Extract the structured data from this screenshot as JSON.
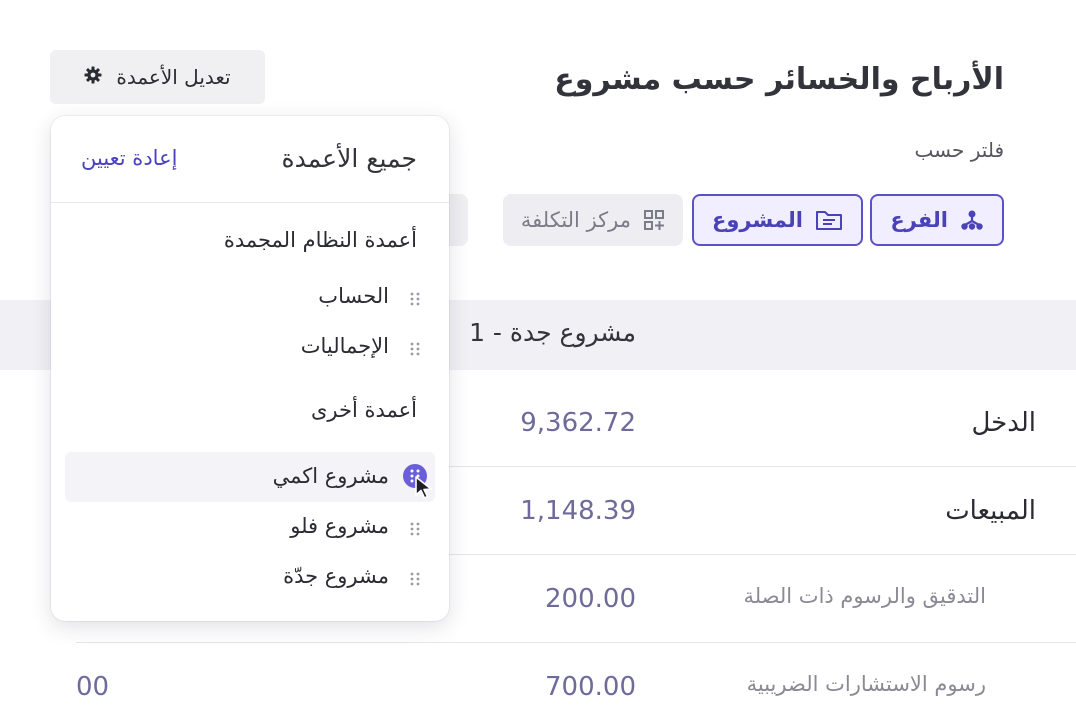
{
  "page": {
    "title": "الأرباح والخسائر حسب مشروع",
    "filter_label": "فلتر حسب",
    "edit_columns_label": "تعديل الأعمدة"
  },
  "filters": [
    {
      "label": "الفرع",
      "icon": "branch-icon",
      "active": true
    },
    {
      "label": "المشروع",
      "icon": "folder-icon",
      "active": true
    },
    {
      "label": "مركز التكلفة",
      "icon": "grid-plus-icon",
      "active": false
    }
  ],
  "table": {
    "project_header": "مشروع جدة - 1",
    "rows": [
      {
        "label": "الدخل",
        "value": "9,362.72",
        "extra": ""
      },
      {
        "label": "المبيعات",
        "value": "1,148.39",
        "extra": ""
      },
      {
        "label": "التدقيق والرسوم ذات الصلة",
        "value": "200.00",
        "extra": ""
      },
      {
        "label": "رسوم الاستشارات الضريبية",
        "value": "700.00",
        "extra": "00"
      }
    ]
  },
  "columns_panel": {
    "title": "جميع الأعمدة",
    "reset_label": "إعادة تعيين",
    "frozen_section": "أعمدة النظام المجمدة",
    "frozen_items": [
      "الحساب",
      "الإجماليات"
    ],
    "other_section": "أعمدة أخرى",
    "other_items": [
      "مشروع اكمي",
      "مشروع فلو",
      "مشروع جدّة"
    ]
  },
  "colors": {
    "accent": "#5b52c8",
    "number": "#6e6a9a",
    "panel_bg": "#ffffff"
  }
}
